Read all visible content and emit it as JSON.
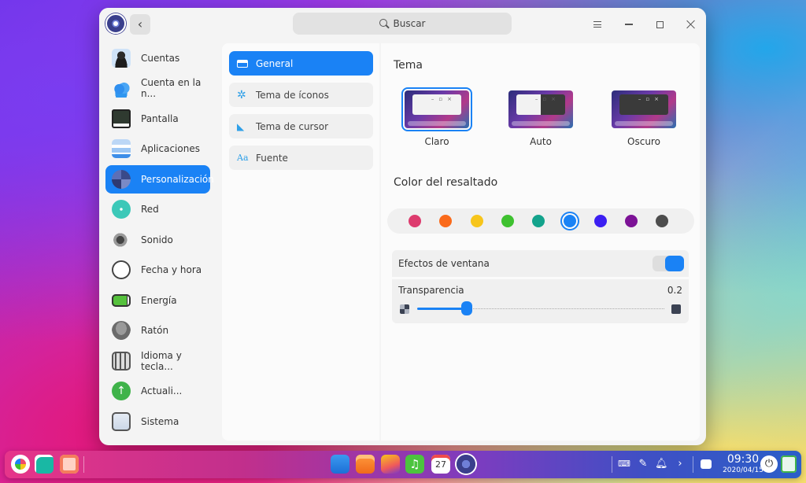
{
  "window": {
    "search_placeholder": "Buscar"
  },
  "sidebar": {
    "items": [
      {
        "label": "Cuentas",
        "icon": "user-account-icon"
      },
      {
        "label": "Cuenta en la n...",
        "icon": "cloud-icon"
      },
      {
        "label": "Pantalla",
        "icon": "monitor-icon"
      },
      {
        "label": "Aplicaciones",
        "icon": "applications-icon"
      },
      {
        "label": "Personalización",
        "icon": "personalization-icon"
      },
      {
        "label": "Red",
        "icon": "network-icon"
      },
      {
        "label": "Sonido",
        "icon": "speaker-icon"
      },
      {
        "label": "Fecha y hora",
        "icon": "clock-icon"
      },
      {
        "label": "Energía",
        "icon": "battery-icon"
      },
      {
        "label": "Ratón",
        "icon": "mouse-icon"
      },
      {
        "label": "Idioma y tecla...",
        "icon": "keyboard-icon"
      },
      {
        "label": "Actuali...",
        "icon": "update-icon"
      },
      {
        "label": "Sistema",
        "icon": "system-icon"
      }
    ],
    "selected_index": 4
  },
  "subnav": {
    "items": [
      {
        "label": "General",
        "icon": "window-icon"
      },
      {
        "label": "Tema de íconos",
        "icon": "icon-theme-icon"
      },
      {
        "label": "Tema de cursor",
        "icon": "cursor-icon"
      },
      {
        "label": "Fuente",
        "icon": "font-icon"
      }
    ],
    "selected_index": 0
  },
  "content": {
    "theme_title": "Tema",
    "themes": [
      {
        "label": "Claro",
        "variant": "light"
      },
      {
        "label": "Auto",
        "variant": "auto"
      },
      {
        "label": "Oscuro",
        "variant": "dark"
      }
    ],
    "selected_theme_index": 0,
    "highlight_title": "Color del resaltado",
    "highlight_colors": [
      "#dd3b6e",
      "#fa6a1a",
      "#f7c51b",
      "#3ec12f",
      "#13a38c",
      "#1a82f5",
      "#3c1ff2",
      "#7c1296",
      "#4d4d4d"
    ],
    "selected_color_index": 5,
    "window_effects_label": "Efectos de ventana",
    "window_effects_enabled": true,
    "transparency_label": "Transparencia",
    "transparency_value": "0.2",
    "transparency_fraction": 0.2
  },
  "dock": {
    "apps_left": [
      "launcher-icon",
      "multitasking-icon",
      "workspace-icon"
    ],
    "apps_center": [
      "file-manager-icon",
      "app-store-icon",
      "image-viewer-icon",
      "music-icon",
      "calendar-icon",
      "settings-icon"
    ],
    "calendar_day": "27",
    "tray": [
      "keyboard-layout-icon",
      "pen-icon",
      "notification-bell-icon",
      "chevron-right-icon"
    ],
    "clock_time": "09:30",
    "clock_date": "2020/04/15"
  }
}
